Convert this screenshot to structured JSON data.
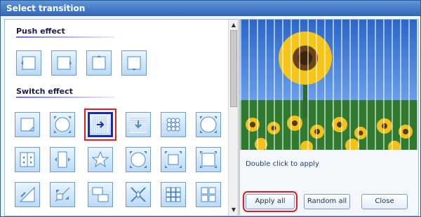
{
  "window": {
    "title": "Select transition"
  },
  "left_panel": {
    "sections": [
      {
        "title": "Push effect"
      },
      {
        "title": "Switch effect"
      }
    ]
  },
  "preview": {
    "helper_text": "Double click to apply"
  },
  "buttons": {
    "apply_all": "Apply all",
    "random_all": "Random all",
    "close": "Close"
  },
  "icons": {
    "tile_border": "#6e9ccd",
    "tile_fill_top": "#e9f4ff",
    "tile_fill_bottom": "#bcdaf6",
    "highlight": "#e81b25",
    "selected_border": "#1b2aa8"
  }
}
